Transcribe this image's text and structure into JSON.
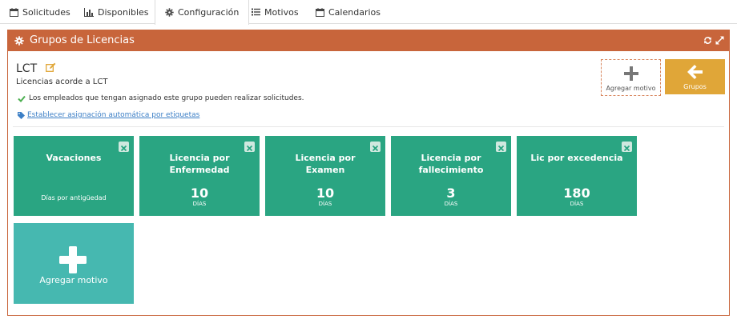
{
  "tabs": [
    {
      "label": "Solicitudes",
      "icon": "calendar-icon"
    },
    {
      "label": "Disponibles",
      "icon": "bar-chart-icon"
    },
    {
      "label": "Configuración",
      "icon": "gear-icon",
      "active": true
    },
    {
      "label": "Motivos",
      "icon": "list-icon"
    },
    {
      "label": "Calendarios",
      "icon": "calendar-icon"
    }
  ],
  "panel": {
    "title": "Grupos de Licencias",
    "group_name": "LCT",
    "group_description": "Licencias acorde a LCT",
    "notice": "Los empleados que tengan asignado este grupo pueden realizar solicitudes.",
    "auto_assign_link": "Establecer asignación automática por etiquetas",
    "add_reason_label": "Agregar motivo",
    "groups_label": "Grupos"
  },
  "cards": [
    {
      "name": "Vacaciones",
      "subtitle": "Días por antigüedad"
    },
    {
      "name": "Licencia por Enfermedad",
      "value": "10",
      "unit": "DÍAS"
    },
    {
      "name": "Licencia por Examen",
      "value": "10",
      "unit": "DÍAS"
    },
    {
      "name": "Licencia por fallecimiento",
      "value": "3",
      "unit": "DÍAS"
    },
    {
      "name": "Lic por excedencia",
      "value": "180",
      "unit": "DÍAS"
    }
  ],
  "add_card_label": "Agregar motivo",
  "colors": {
    "header": "#c8653b",
    "card": "#2aa582",
    "add_card": "#46b8b0",
    "groups_button": "#e0a638",
    "link": "#3c7fc6",
    "check": "#4caf50"
  }
}
